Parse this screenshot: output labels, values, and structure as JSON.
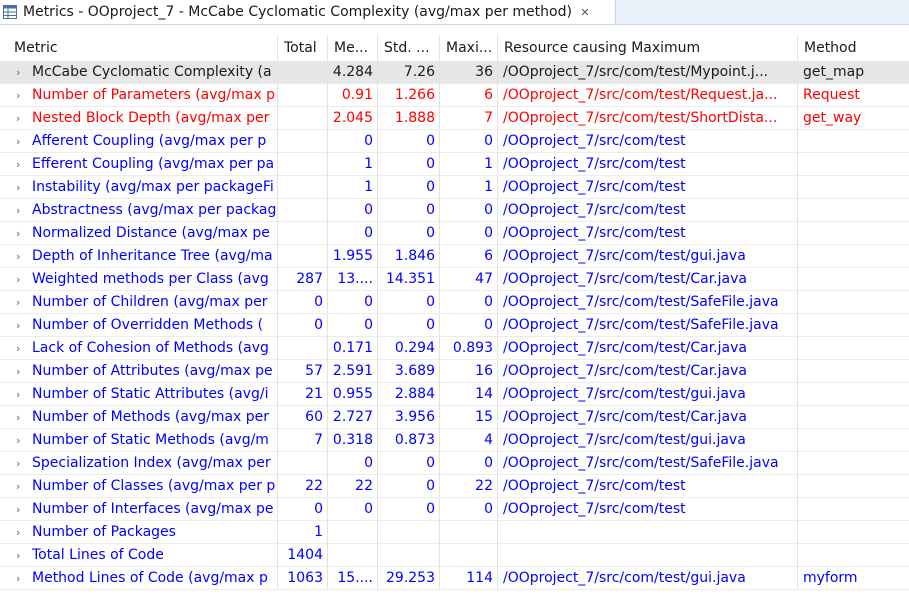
{
  "tab": {
    "title": "Metrics - OOproject_7 - McCabe Cyclomatic Complexity (avg/max per method)",
    "close_symbol": "✕",
    "icon": "metrics-table-icon"
  },
  "columns": [
    "Metric",
    "Total",
    "Me...",
    "Std. ...",
    "Maxi...",
    "Resource causing Maximum",
    "Method"
  ],
  "colors": {
    "default_text": "#1a1a1a",
    "blue": "#0000ff",
    "red": "#ff0000",
    "selected_row": "#e6e6e6"
  },
  "rows": [
    {
      "metric": "McCabe Cyclomatic Complexity (a",
      "total": "",
      "mean": "4.284",
      "std": "7.26",
      "max": "36",
      "resource": "/OOproject_7/src/com/test/Mypoint.j...",
      "method": "get_map",
      "color": "default",
      "selected": true
    },
    {
      "metric": "Number of Parameters (avg/max p",
      "total": "",
      "mean": "0.91",
      "std": "1.266",
      "max": "6",
      "resource": "/OOproject_7/src/com/test/Request.ja...",
      "method": "Request",
      "color": "red",
      "selected": false
    },
    {
      "metric": "Nested Block Depth (avg/max per",
      "total": "",
      "mean": "2.045",
      "std": "1.888",
      "max": "7",
      "resource": "/OOproject_7/src/com/test/ShortDista...",
      "method": "get_way",
      "color": "red",
      "selected": false
    },
    {
      "metric": "Afferent Coupling (avg/max per p",
      "total": "",
      "mean": "0",
      "std": "0",
      "max": "0",
      "resource": "/OOproject_7/src/com/test",
      "method": "",
      "color": "blue",
      "selected": false
    },
    {
      "metric": "Efferent Coupling (avg/max per pa",
      "total": "",
      "mean": "1",
      "std": "0",
      "max": "1",
      "resource": "/OOproject_7/src/com/test",
      "method": "",
      "color": "blue",
      "selected": false
    },
    {
      "metric": "Instability (avg/max per packageFi",
      "total": "",
      "mean": "1",
      "std": "0",
      "max": "1",
      "resource": "/OOproject_7/src/com/test",
      "method": "",
      "color": "blue",
      "selected": false
    },
    {
      "metric": "Abstractness (avg/max per packag",
      "total": "",
      "mean": "0",
      "std": "0",
      "max": "0",
      "resource": "/OOproject_7/src/com/test",
      "method": "",
      "color": "blue",
      "selected": false
    },
    {
      "metric": "Normalized Distance (avg/max pe",
      "total": "",
      "mean": "0",
      "std": "0",
      "max": "0",
      "resource": "/OOproject_7/src/com/test",
      "method": "",
      "color": "blue",
      "selected": false
    },
    {
      "metric": "Depth of Inheritance Tree (avg/ma",
      "total": "",
      "mean": "1.955",
      "std": "1.846",
      "max": "6",
      "resource": "/OOproject_7/src/com/test/gui.java",
      "method": "",
      "color": "blue",
      "selected": false
    },
    {
      "metric": "Weighted methods per Class (avg",
      "total": "287",
      "mean": "13....",
      "std": "14.351",
      "max": "47",
      "resource": "/OOproject_7/src/com/test/Car.java",
      "method": "",
      "color": "blue",
      "selected": false
    },
    {
      "metric": "Number of Children (avg/max per",
      "total": "0",
      "mean": "0",
      "std": "0",
      "max": "0",
      "resource": "/OOproject_7/src/com/test/SafeFile.java",
      "method": "",
      "color": "blue",
      "selected": false
    },
    {
      "metric": "Number of Overridden Methods (",
      "total": "0",
      "mean": "0",
      "std": "0",
      "max": "0",
      "resource": "/OOproject_7/src/com/test/SafeFile.java",
      "method": "",
      "color": "blue",
      "selected": false
    },
    {
      "metric": "Lack of Cohesion of Methods (avg",
      "total": "",
      "mean": "0.171",
      "std": "0.294",
      "max": "0.893",
      "resource": "/OOproject_7/src/com/test/Car.java",
      "method": "",
      "color": "blue",
      "selected": false
    },
    {
      "metric": "Number of Attributes (avg/max pe",
      "total": "57",
      "mean": "2.591",
      "std": "3.689",
      "max": "16",
      "resource": "/OOproject_7/src/com/test/Car.java",
      "method": "",
      "color": "blue",
      "selected": false
    },
    {
      "metric": "Number of Static Attributes (avg/i",
      "total": "21",
      "mean": "0.955",
      "std": "2.884",
      "max": "14",
      "resource": "/OOproject_7/src/com/test/gui.java",
      "method": "",
      "color": "blue",
      "selected": false
    },
    {
      "metric": "Number of Methods (avg/max per",
      "total": "60",
      "mean": "2.727",
      "std": "3.956",
      "max": "15",
      "resource": "/OOproject_7/src/com/test/Car.java",
      "method": "",
      "color": "blue",
      "selected": false
    },
    {
      "metric": "Number of Static Methods (avg/m",
      "total": "7",
      "mean": "0.318",
      "std": "0.873",
      "max": "4",
      "resource": "/OOproject_7/src/com/test/gui.java",
      "method": "",
      "color": "blue",
      "selected": false
    },
    {
      "metric": "Specialization Index (avg/max per",
      "total": "",
      "mean": "0",
      "std": "0",
      "max": "0",
      "resource": "/OOproject_7/src/com/test/SafeFile.java",
      "method": "",
      "color": "blue",
      "selected": false
    },
    {
      "metric": "Number of Classes (avg/max per p",
      "total": "22",
      "mean": "22",
      "std": "0",
      "max": "22",
      "resource": "/OOproject_7/src/com/test",
      "method": "",
      "color": "blue",
      "selected": false
    },
    {
      "metric": "Number of Interfaces (avg/max pe",
      "total": "0",
      "mean": "0",
      "std": "0",
      "max": "0",
      "resource": "/OOproject_7/src/com/test",
      "method": "",
      "color": "blue",
      "selected": false
    },
    {
      "metric": "Number of Packages",
      "total": "1",
      "mean": "",
      "std": "",
      "max": "",
      "resource": "",
      "method": "",
      "color": "blue",
      "selected": false
    },
    {
      "metric": "Total Lines of Code",
      "total": "1404",
      "mean": "",
      "std": "",
      "max": "",
      "resource": "",
      "method": "",
      "color": "blue",
      "selected": false
    },
    {
      "metric": "Method Lines of Code (avg/max p",
      "total": "1063",
      "mean": "15....",
      "std": "29.253",
      "max": "114",
      "resource": "/OOproject_7/src/com/test/gui.java",
      "method": "myform",
      "color": "blue",
      "selected": false
    }
  ]
}
